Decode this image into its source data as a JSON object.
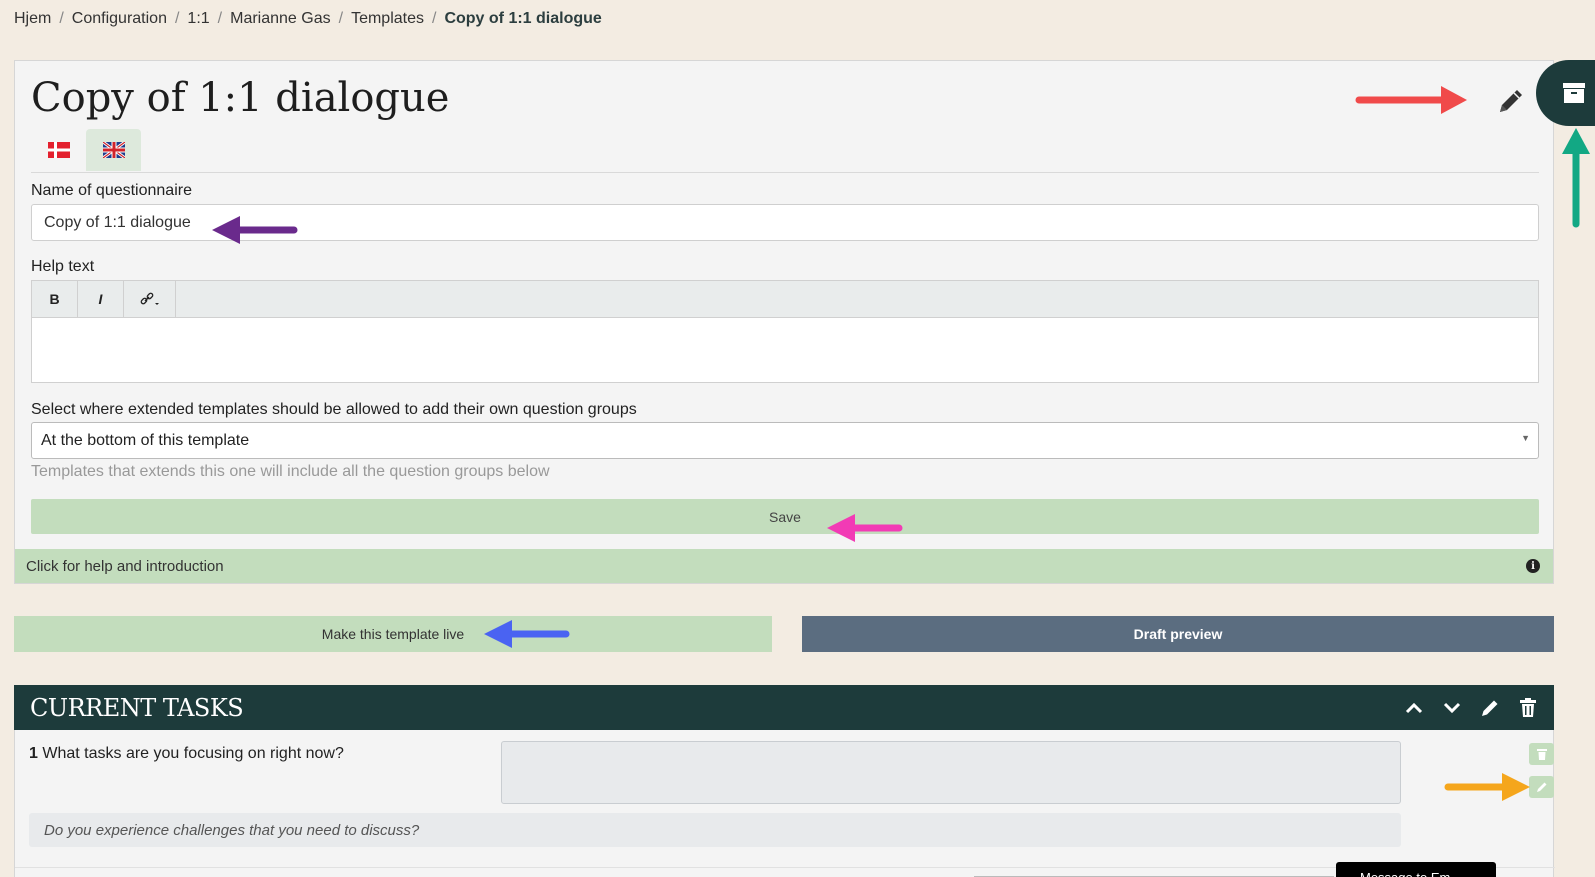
{
  "breadcrumb": [
    "Hjem",
    "Configuration",
    "1:1",
    "Marianne Gas",
    "Templates",
    "Copy of 1:1 dialogue"
  ],
  "page": {
    "title": "Copy of 1:1 dialogue"
  },
  "languages": [
    {
      "name": "danish-flag-icon",
      "active": false
    },
    {
      "name": "uk-flag-icon",
      "active": true
    }
  ],
  "form": {
    "name_label": "Name of questionnaire",
    "name_value": "Copy of 1:1 dialogue",
    "help_label": "Help text",
    "toolbar": {
      "bold": "B",
      "italic": "I"
    },
    "extend_label": "Select where extended templates should be allowed to add their own question groups",
    "extend_value": "At the bottom of this template",
    "extend_hint": "Templates that extends this one will include all the question groups below",
    "save_label": "Save",
    "help_bar": "Click for help and introduction"
  },
  "actions": {
    "make_live": "Make this template live",
    "draft_preview": "Draft preview"
  },
  "section": {
    "title": "CURRENT TASKS",
    "question_number": "1",
    "question_text": "What tasks are you focusing on right now?",
    "sub_question": "Do you experience challenges that you need to discuss?",
    "tooltip_text": "Message to Em..."
  },
  "colors": {
    "background": "#f3ece2",
    "dark_teal": "#1d3b3b",
    "light_green": "#c3ddbd",
    "slate": "#5b6d80",
    "arrow_red": "#f04a4a",
    "arrow_purple": "#6a2a8c",
    "arrow_pink": "#f23bb5",
    "arrow_blue": "#4a63f2",
    "arrow_teal": "#12a884",
    "arrow_orange": "#f5a61c"
  }
}
